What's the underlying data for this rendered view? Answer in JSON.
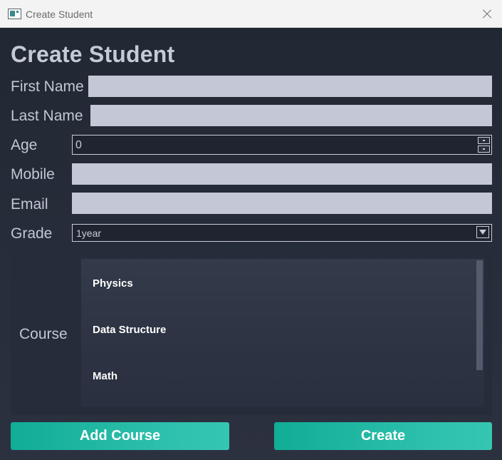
{
  "window": {
    "title": "Create Student"
  },
  "form": {
    "heading": "Create Student",
    "first_name": {
      "label": "First Name",
      "value": ""
    },
    "last_name": {
      "label": "Last Name",
      "value": ""
    },
    "age": {
      "label": "Age",
      "value": "0"
    },
    "mobile": {
      "label": "Mobile",
      "value": ""
    },
    "email": {
      "label": "Email",
      "value": ""
    },
    "grade": {
      "label": "Grade",
      "selected": "1year"
    },
    "course": {
      "label": "Course",
      "items": [
        "Physics",
        "Data Structure",
        "Math"
      ]
    }
  },
  "buttons": {
    "add_course": "Add Course",
    "create": "Create"
  },
  "colors": {
    "accent": "#1ab39e",
    "input_bg": "#c4c8d6",
    "background": "#212833"
  },
  "icons": {
    "window": "app-window-icon",
    "close": "close-icon",
    "dropdown": "chevron-down-icon"
  }
}
